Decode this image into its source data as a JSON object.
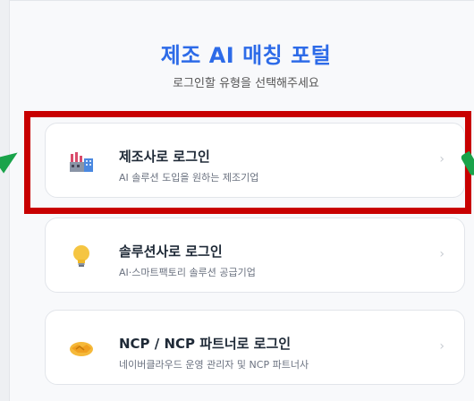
{
  "header": {
    "title": "제조 AI 매칭 포털",
    "subtitle": "로그인할 유형을 선택해주세요"
  },
  "cards": [
    {
      "title": "제조사로 로그인",
      "description": "AI 솔루션 도입을 원하는 제조기업",
      "icon": "factory-icon"
    },
    {
      "title": "솔루션사로 로그인",
      "description": "AI·스마트팩토리 솔루션 공급기업",
      "icon": "lightbulb-icon"
    },
    {
      "title": "NCP / NCP 파트너로 로그인",
      "description": "네이버클라우드 운영 관리자 및 NCP 파트너사",
      "icon": "handshake-icon"
    }
  ],
  "colors": {
    "accent": "#2d6be8",
    "highlight": "#c80000",
    "arrow": "#19a34a"
  }
}
